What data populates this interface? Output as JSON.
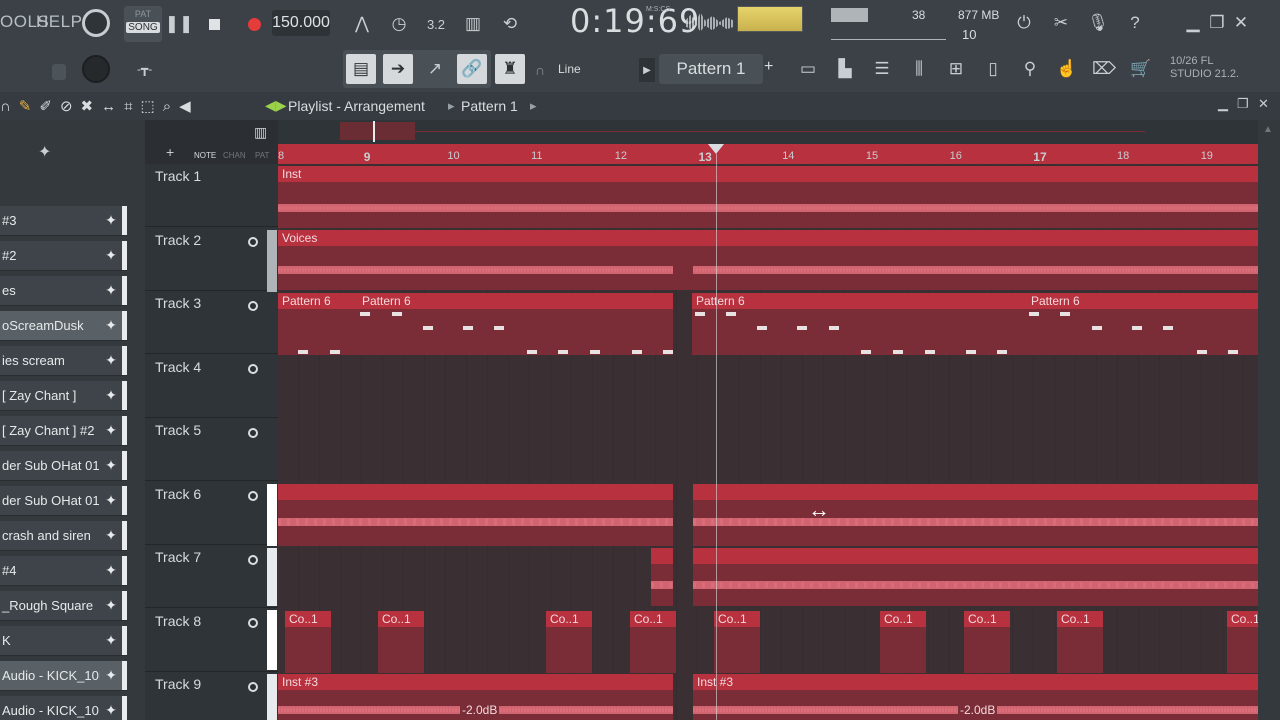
{
  "menu": {
    "tools": "OOLS",
    "help": "HELP"
  },
  "transport": {
    "pat_label": "PAT",
    "song_label": "SONG",
    "tempo": "150.000",
    "time": "0:19:69",
    "time_unit": "M:S:CS"
  },
  "perf": {
    "cpu_value": "38",
    "memory": "877 MB",
    "voices": "10"
  },
  "toolbar2": {
    "snap_mode": "Line",
    "pattern_name": "Pattern 1"
  },
  "version": {
    "date": "10/26",
    "fl": "FL",
    "studio": "STUDIO 21.2."
  },
  "playlist": {
    "title": "Playlist - Arrangement",
    "crumb": "Pattern 1"
  },
  "toggles": {
    "note": "NOTE",
    "chan": "CHAN",
    "pat": "PAT"
  },
  "ruler": [
    "8",
    "9",
    "10",
    "11",
    "12",
    "13",
    "14",
    "15",
    "16",
    "17",
    "18",
    "19"
  ],
  "tracks": [
    "Track 1",
    "Track 2",
    "Track 3",
    "Track 4",
    "Track 5",
    "Track 6",
    "Track 7",
    "Track 8",
    "Track 9"
  ],
  "channels": [
    "#3",
    "#2",
    "es",
    "oScreamDusk",
    "ies scream",
    "[ Zay Chant ]",
    "[ Zay Chant ] #2",
    "der Sub OHat 01",
    "der Sub OHat 01..",
    "crash and siren",
    "#4",
    "_Rough Square",
    "K",
    "Audio - KICK_10K",
    "Audio - KICK_10.."
  ],
  "clips": {
    "inst": "Inst",
    "voices": "Voices",
    "pattern6": "Pattern 6",
    "co1": "Co..1",
    "inst3": "Inst #3",
    "gain": "-2.0dB"
  },
  "colors": {
    "clip": "#b8313f",
    "clip_body": "#7a2d36",
    "wave": "#e57a86",
    "accent": "#9ad34a"
  }
}
